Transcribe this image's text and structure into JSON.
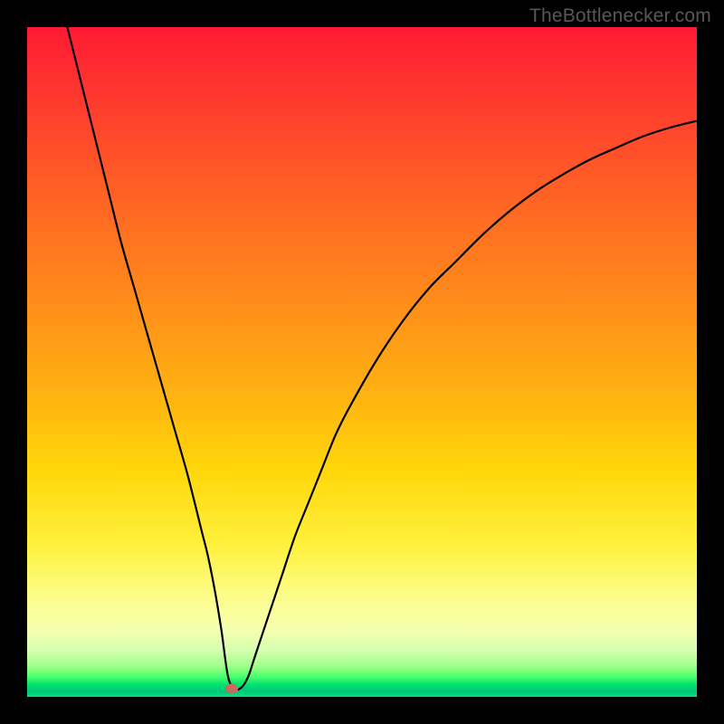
{
  "watermark": {
    "text": "TheBottlenecker.com"
  },
  "colors": {
    "background": "#000000",
    "curve": "#000000",
    "marker": "#c96a5e"
  },
  "chart_data": {
    "type": "line",
    "title": "",
    "xlabel": "",
    "ylabel": "",
    "xlim": [
      0,
      100
    ],
    "ylim": [
      0,
      100
    ],
    "grid": false,
    "legend": false,
    "annotations": [],
    "marker": {
      "x": 30.5,
      "y": 1.2
    },
    "series": [
      {
        "name": "bottleneck-curve",
        "x": [
          6,
          8,
          10,
          12,
          14,
          16,
          18,
          20,
          22,
          24,
          26,
          27,
          28,
          29,
          30,
          31,
          32,
          33,
          34,
          36,
          38,
          40,
          42,
          44,
          46,
          48,
          52,
          56,
          60,
          64,
          68,
          72,
          76,
          80,
          84,
          88,
          92,
          96,
          100
        ],
        "y": [
          100,
          92,
          84,
          76,
          68,
          61,
          54,
          47,
          40,
          33,
          25,
          21,
          16,
          10,
          3,
          1.2,
          1.4,
          3,
          6,
          12,
          18,
          24,
          29,
          34,
          39,
          43,
          50,
          56,
          61,
          65,
          69,
          72.5,
          75.5,
          78,
          80.2,
          82,
          83.7,
          85,
          86
        ]
      }
    ]
  }
}
